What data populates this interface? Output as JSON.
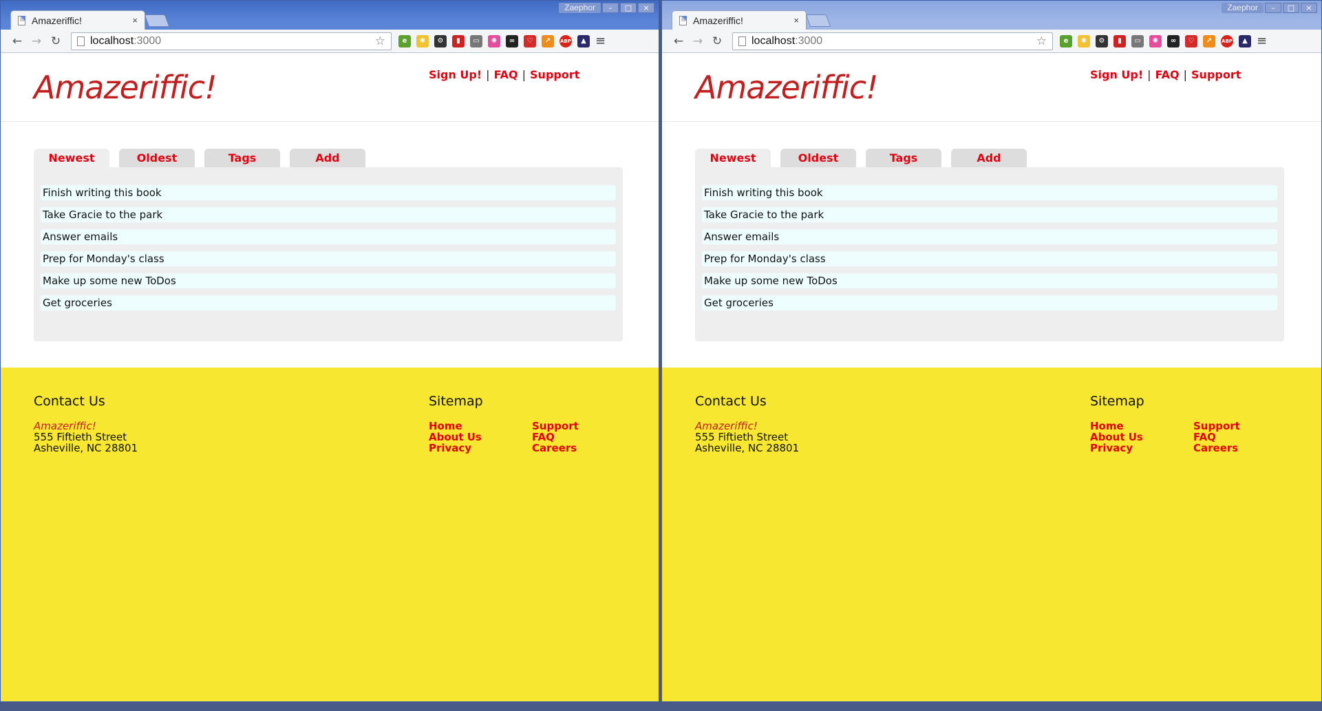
{
  "browser": {
    "tab_title": "Amazeriffic!",
    "tab_close": "×",
    "profile_name": "Zaephor",
    "url_host": "localhost",
    "url_port": ":3000",
    "window_buttons": [
      "–",
      "□",
      "×"
    ],
    "nav": {
      "back": "←",
      "forward": "→",
      "reload": "↻"
    },
    "star": "☆",
    "menu": "≡",
    "extensions": [
      {
        "name": "evernote-icon",
        "color": "#5aa02c",
        "label": "e"
      },
      {
        "name": "note-icon",
        "color": "#f2c230",
        "label": "✱"
      },
      {
        "name": "gear-icon",
        "color": "#333333",
        "label": "⚙"
      },
      {
        "name": "red-ext-icon",
        "color": "#cc2222",
        "label": "▮"
      },
      {
        "name": "cast-icon",
        "color": "#777777",
        "label": "▭"
      },
      {
        "name": "color-wheel-icon",
        "color": "#e44c9c",
        "label": "✺"
      },
      {
        "name": "glasses-icon",
        "color": "#222222",
        "label": "∞"
      },
      {
        "name": "heart-icon",
        "color": "#d42a2a",
        "label": "♡"
      },
      {
        "name": "chart-icon",
        "color": "#f08c1c",
        "label": "↗"
      },
      {
        "name": "adblock-icon",
        "color": "#d8231b",
        "label": "ABP"
      },
      {
        "name": "dark-ext-icon",
        "color": "#2a2a6a",
        "label": "▲"
      }
    ]
  },
  "site": {
    "logo": "Amazeriffic!",
    "topnav": [
      "Sign Up!",
      "FAQ",
      "Support"
    ],
    "separator": "|",
    "tabs": [
      "Newest",
      "Oldest",
      "Tags",
      "Add"
    ],
    "todos": [
      "Finish writing this book",
      "Take Gracie to the park",
      "Answer emails",
      "Prep for Monday's class",
      "Make up some new ToDos",
      "Get groceries"
    ],
    "footer": {
      "contact_title": "Contact Us",
      "company": "Amazeriffic!",
      "street": "555 Fiftieth Street",
      "city": "Asheville, NC 28801",
      "sitemap_title": "Sitemap",
      "sitemap_col1": [
        "Home",
        "About Us",
        "Privacy"
      ],
      "sitemap_col2": [
        "Support",
        "FAQ",
        "Careers"
      ]
    }
  }
}
